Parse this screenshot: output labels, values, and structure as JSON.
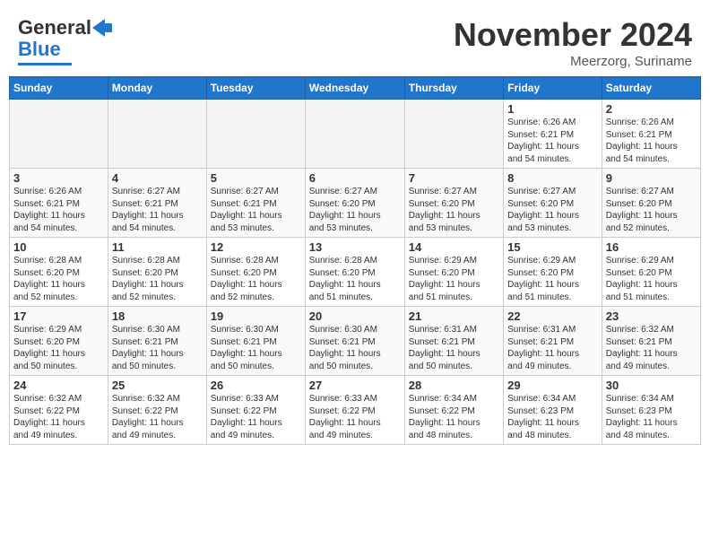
{
  "header": {
    "logo_general": "General",
    "logo_blue": "Blue",
    "month_title": "November 2024",
    "location": "Meerzorg, Suriname"
  },
  "weekdays": [
    "Sunday",
    "Monday",
    "Tuesday",
    "Wednesday",
    "Thursday",
    "Friday",
    "Saturday"
  ],
  "weeks": [
    [
      {
        "day": "",
        "info": ""
      },
      {
        "day": "",
        "info": ""
      },
      {
        "day": "",
        "info": ""
      },
      {
        "day": "",
        "info": ""
      },
      {
        "day": "",
        "info": ""
      },
      {
        "day": "1",
        "info": "Sunrise: 6:26 AM\nSunset: 6:21 PM\nDaylight: 11 hours\nand 54 minutes."
      },
      {
        "day": "2",
        "info": "Sunrise: 6:26 AM\nSunset: 6:21 PM\nDaylight: 11 hours\nand 54 minutes."
      }
    ],
    [
      {
        "day": "3",
        "info": "Sunrise: 6:26 AM\nSunset: 6:21 PM\nDaylight: 11 hours\nand 54 minutes."
      },
      {
        "day": "4",
        "info": "Sunrise: 6:27 AM\nSunset: 6:21 PM\nDaylight: 11 hours\nand 54 minutes."
      },
      {
        "day": "5",
        "info": "Sunrise: 6:27 AM\nSunset: 6:21 PM\nDaylight: 11 hours\nand 53 minutes."
      },
      {
        "day": "6",
        "info": "Sunrise: 6:27 AM\nSunset: 6:20 PM\nDaylight: 11 hours\nand 53 minutes."
      },
      {
        "day": "7",
        "info": "Sunrise: 6:27 AM\nSunset: 6:20 PM\nDaylight: 11 hours\nand 53 minutes."
      },
      {
        "day": "8",
        "info": "Sunrise: 6:27 AM\nSunset: 6:20 PM\nDaylight: 11 hours\nand 53 minutes."
      },
      {
        "day": "9",
        "info": "Sunrise: 6:27 AM\nSunset: 6:20 PM\nDaylight: 11 hours\nand 52 minutes."
      }
    ],
    [
      {
        "day": "10",
        "info": "Sunrise: 6:28 AM\nSunset: 6:20 PM\nDaylight: 11 hours\nand 52 minutes."
      },
      {
        "day": "11",
        "info": "Sunrise: 6:28 AM\nSunset: 6:20 PM\nDaylight: 11 hours\nand 52 minutes."
      },
      {
        "day": "12",
        "info": "Sunrise: 6:28 AM\nSunset: 6:20 PM\nDaylight: 11 hours\nand 52 minutes."
      },
      {
        "day": "13",
        "info": "Sunrise: 6:28 AM\nSunset: 6:20 PM\nDaylight: 11 hours\nand 51 minutes."
      },
      {
        "day": "14",
        "info": "Sunrise: 6:29 AM\nSunset: 6:20 PM\nDaylight: 11 hours\nand 51 minutes."
      },
      {
        "day": "15",
        "info": "Sunrise: 6:29 AM\nSunset: 6:20 PM\nDaylight: 11 hours\nand 51 minutes."
      },
      {
        "day": "16",
        "info": "Sunrise: 6:29 AM\nSunset: 6:20 PM\nDaylight: 11 hours\nand 51 minutes."
      }
    ],
    [
      {
        "day": "17",
        "info": "Sunrise: 6:29 AM\nSunset: 6:20 PM\nDaylight: 11 hours\nand 50 minutes."
      },
      {
        "day": "18",
        "info": "Sunrise: 6:30 AM\nSunset: 6:21 PM\nDaylight: 11 hours\nand 50 minutes."
      },
      {
        "day": "19",
        "info": "Sunrise: 6:30 AM\nSunset: 6:21 PM\nDaylight: 11 hours\nand 50 minutes."
      },
      {
        "day": "20",
        "info": "Sunrise: 6:30 AM\nSunset: 6:21 PM\nDaylight: 11 hours\nand 50 minutes."
      },
      {
        "day": "21",
        "info": "Sunrise: 6:31 AM\nSunset: 6:21 PM\nDaylight: 11 hours\nand 50 minutes."
      },
      {
        "day": "22",
        "info": "Sunrise: 6:31 AM\nSunset: 6:21 PM\nDaylight: 11 hours\nand 49 minutes."
      },
      {
        "day": "23",
        "info": "Sunrise: 6:32 AM\nSunset: 6:21 PM\nDaylight: 11 hours\nand 49 minutes."
      }
    ],
    [
      {
        "day": "24",
        "info": "Sunrise: 6:32 AM\nSunset: 6:22 PM\nDaylight: 11 hours\nand 49 minutes."
      },
      {
        "day": "25",
        "info": "Sunrise: 6:32 AM\nSunset: 6:22 PM\nDaylight: 11 hours\nand 49 minutes."
      },
      {
        "day": "26",
        "info": "Sunrise: 6:33 AM\nSunset: 6:22 PM\nDaylight: 11 hours\nand 49 minutes."
      },
      {
        "day": "27",
        "info": "Sunrise: 6:33 AM\nSunset: 6:22 PM\nDaylight: 11 hours\nand 49 minutes."
      },
      {
        "day": "28",
        "info": "Sunrise: 6:34 AM\nSunset: 6:22 PM\nDaylight: 11 hours\nand 48 minutes."
      },
      {
        "day": "29",
        "info": "Sunrise: 6:34 AM\nSunset: 6:23 PM\nDaylight: 11 hours\nand 48 minutes."
      },
      {
        "day": "30",
        "info": "Sunrise: 6:34 AM\nSunset: 6:23 PM\nDaylight: 11 hours\nand 48 minutes."
      }
    ]
  ]
}
